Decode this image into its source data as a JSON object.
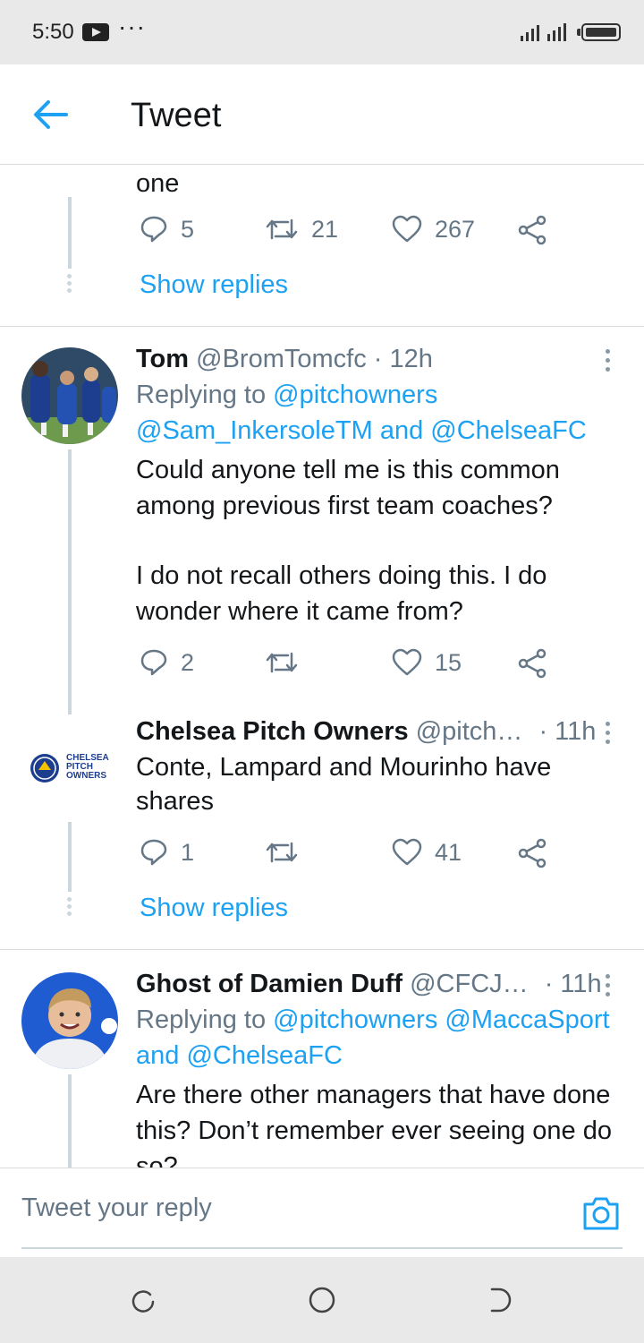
{
  "status_bar": {
    "time": "5:50",
    "more": "···"
  },
  "header": {
    "title": "Tweet"
  },
  "tweets": [
    {
      "text_tail": "one",
      "actions": {
        "replies": "5",
        "retweets": "21",
        "likes": "267"
      },
      "show_replies": "Show replies"
    },
    {
      "name": "Tom",
      "handle": "@BromTomcfc",
      "time": "· 12h",
      "replying_prefix": "Replying to",
      "replying_1": "@pitchowners",
      "replying_2": "@Sam_InkersoleTM",
      "replying_and": "and",
      "replying_3": "@ChelseaFC",
      "lines": [
        "Could anyone tell me is this common",
        "among previous first team coaches?",
        "I do not recall others doing this. I do",
        "wonder where it came from?"
      ],
      "actions": {
        "replies": "2",
        "retweets": "",
        "likes": "15"
      }
    },
    {
      "name": "Chelsea Pitch Owners",
      "handle": "@pitch…",
      "time": "· 11h",
      "avatar_text": [
        "CHELSEA",
        "PITCH",
        "OWNERS"
      ],
      "lines": [
        "Conte, Lampard and Mourinho have",
        "shares"
      ],
      "actions": {
        "replies": "1",
        "retweets": "",
        "likes": "41"
      },
      "show_replies": "Show replies"
    },
    {
      "name": "Ghost of Damien Duff",
      "handle": "@CFCJ…",
      "time": "· 11h",
      "replying_prefix": "Replying to",
      "replying_1": "@pitchowners",
      "replying_2": "@MaccaSport",
      "replying_and": "and",
      "replying_3": "@ChelseaFC",
      "lines": [
        "Are there other managers that have done",
        "this? Don’t remember ever seeing one do",
        "so?"
      ]
    }
  ],
  "reply_bar": {
    "placeholder": "Tweet your reply"
  },
  "colors": {
    "accent": "#1da1f2",
    "muted": "#657786",
    "divider": "#d9dde0",
    "thread": "#ccd6dd"
  },
  "icons": [
    "back-arrow-icon",
    "reply-icon",
    "retweet-icon",
    "like-icon",
    "share-icon",
    "more-icon",
    "camera-icon",
    "recent-apps-icon",
    "home-icon",
    "back-nav-icon"
  ]
}
